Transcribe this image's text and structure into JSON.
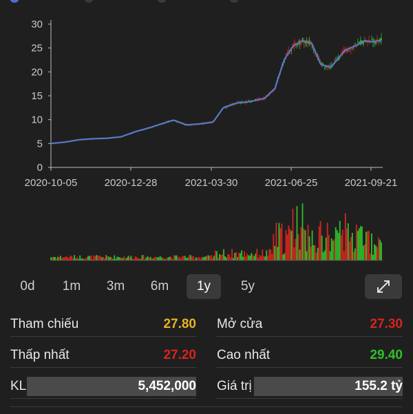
{
  "chart_data": {
    "type": "candlestick",
    "x_ticks": [
      "2020-10-05",
      "2020-12-28",
      "2021-03-30",
      "2021-06-25",
      "2021-09-21"
    ],
    "y_ticks": [
      "0",
      "5",
      "10",
      "15",
      "20",
      "25",
      "30"
    ],
    "ylim": [
      0,
      30
    ],
    "price_series": {
      "name": "",
      "points": [
        [
          "2020-10-05",
          5.0
        ],
        [
          "2020-10-20",
          5.3
        ],
        [
          "2020-11-05",
          5.8
        ],
        [
          "2020-11-20",
          6.0
        ],
        [
          "2020-12-05",
          6.1
        ],
        [
          "2020-12-20",
          6.4
        ],
        [
          "2021-01-05",
          7.5
        ],
        [
          "2021-01-20",
          8.3
        ],
        [
          "2021-02-05",
          9.3
        ],
        [
          "2021-02-15",
          9.9
        ],
        [
          "2021-03-01",
          8.9
        ],
        [
          "2021-03-15",
          9.1
        ],
        [
          "2021-03-30",
          9.5
        ],
        [
          "2021-04-10",
          12.5
        ],
        [
          "2021-04-25",
          13.5
        ],
        [
          "2021-05-10",
          13.8
        ],
        [
          "2021-05-25",
          14.5
        ],
        [
          "2021-06-05",
          16.5
        ],
        [
          "2021-06-15",
          22.5
        ],
        [
          "2021-06-25",
          25.5
        ],
        [
          "2021-07-05",
          26.5
        ],
        [
          "2021-07-15",
          26.0
        ],
        [
          "2021-07-25",
          21.5
        ],
        [
          "2021-08-05",
          21.0
        ],
        [
          "2021-08-20",
          24.5
        ],
        [
          "2021-09-01",
          25.5
        ],
        [
          "2021-09-10",
          26.5
        ],
        [
          "2021-09-21",
          26.3
        ],
        [
          "2021-09-30",
          26.8
        ]
      ]
    },
    "volume_bars": "shown below price chart"
  },
  "ranges": {
    "items": [
      {
        "label": "0d"
      },
      {
        "label": "1m"
      },
      {
        "label": "3m"
      },
      {
        "label": "6m"
      },
      {
        "label": "1y"
      },
      {
        "label": "5y"
      }
    ],
    "active": "1y"
  },
  "stats": {
    "tham_chieu": {
      "label": "Tham chiếu",
      "value": "27.80"
    },
    "mo_cua": {
      "label": "Mở cửa",
      "value": "27.30"
    },
    "thap_nhat": {
      "label": "Thấp nhất",
      "value": "27.20"
    },
    "cao_nhat": {
      "label": "Cao nhất",
      "value": "29.40"
    },
    "kl": {
      "label": "KL",
      "value": "5,452,000"
    },
    "gia_tri": {
      "label": "Giá trị",
      "value": "155.2 tỷ"
    }
  },
  "colors": {
    "up": "#2fc02a",
    "down": "#d6241f",
    "ref": "#e6b422",
    "line": "#5a78c8"
  }
}
